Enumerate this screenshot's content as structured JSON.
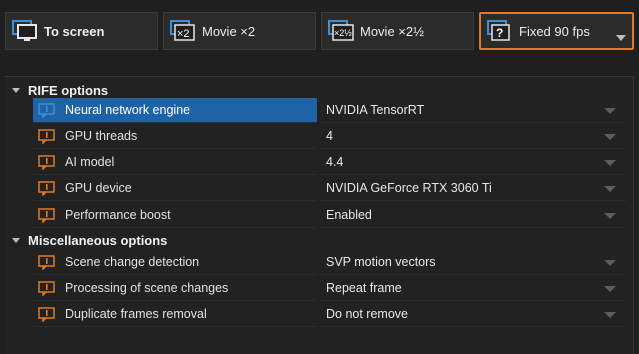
{
  "modes": [
    {
      "label": "To screen",
      "icon": "monitor-icon",
      "active": false,
      "bold": true
    },
    {
      "label": "Movie ×2",
      "icon": "movie-x2-icon",
      "active": false,
      "bold": false
    },
    {
      "label": "Movie ×2½",
      "icon": "movie-x2half-icon",
      "active": false,
      "bold": false
    },
    {
      "label": "Fixed 90 fps",
      "icon": "question-monitor-icon",
      "active": true,
      "bold": false
    }
  ],
  "colors": {
    "accent_orange": "#e07a26",
    "selection_blue": "#1f63a7",
    "icon_blue": "#3e8fd6"
  },
  "groups": [
    {
      "title": "RIFE options",
      "rows": [
        {
          "name": "Neural network engine",
          "value": "NVIDIA TensorRT",
          "selected": true
        },
        {
          "name": "GPU threads",
          "value": "4",
          "selected": false
        },
        {
          "name": "AI model",
          "value": "4.4",
          "selected": false
        },
        {
          "name": "GPU device",
          "value": "NVIDIA GeForce RTX 3060 Ti",
          "selected": false
        },
        {
          "name": "Performance boost",
          "value": "Enabled",
          "selected": false
        }
      ]
    },
    {
      "title": "Miscellaneous options",
      "rows": [
        {
          "name": "Scene change detection",
          "value": "SVP motion vectors",
          "selected": false
        },
        {
          "name": "Processing of scene changes",
          "value": "Repeat frame",
          "selected": false
        },
        {
          "name": "Duplicate frames removal",
          "value": "Do not remove",
          "selected": false
        }
      ]
    }
  ]
}
